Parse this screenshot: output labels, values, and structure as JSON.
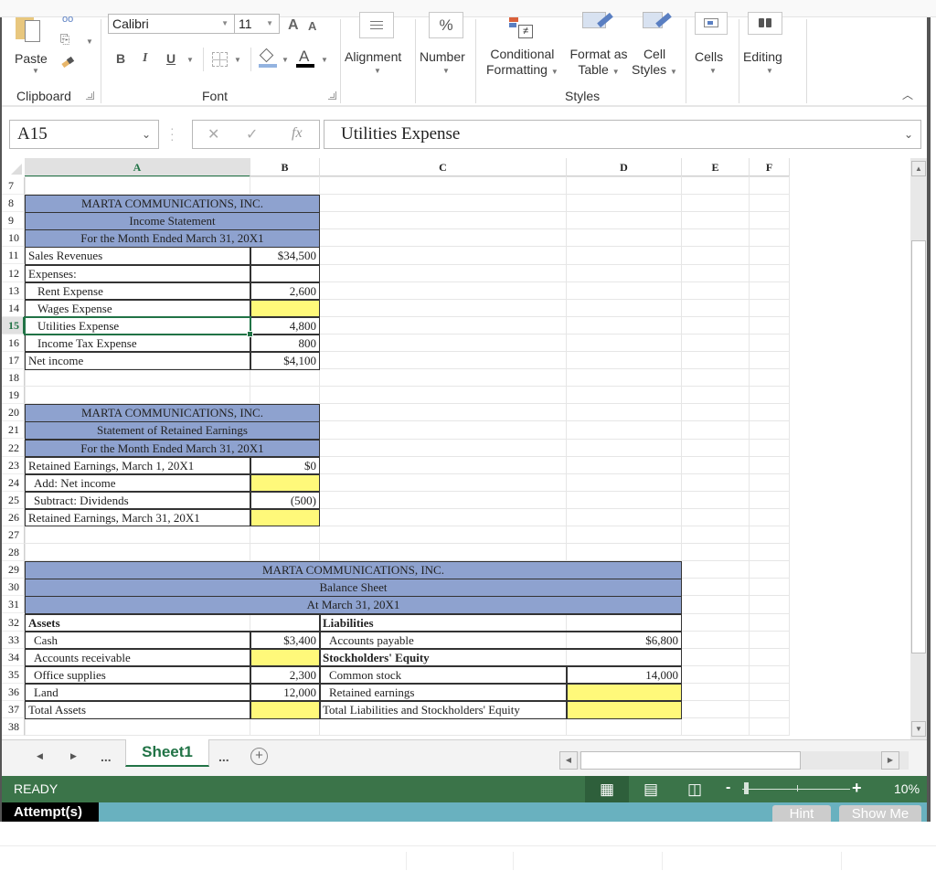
{
  "ribbon": {
    "clipboard": {
      "paste_label": "Paste",
      "group_label": "Clipboard"
    },
    "font": {
      "font_name": "Calibri",
      "font_size": "11",
      "bold": "B",
      "italic": "I",
      "underline": "U",
      "grow_font": "A",
      "shrink_font": "A",
      "group_label": "Font"
    },
    "alignment": {
      "label": "Alignment"
    },
    "number": {
      "label": "Number",
      "icon_glyph": "%"
    },
    "styles": {
      "conditional_formatting_l1": "Conditional",
      "conditional_formatting_l2": "Formatting",
      "format_as_table_l1": "Format as",
      "format_as_table_l2": "Table",
      "cell_styles_l1": "Cell",
      "cell_styles_l2": "Styles",
      "group_label": "Styles"
    },
    "cells": {
      "label": "Cells"
    },
    "editing": {
      "label": "Editing"
    }
  },
  "formula_bar": {
    "name_box": "A15",
    "fx": "fx",
    "content": "Utilities Expense"
  },
  "columns": [
    "A",
    "B",
    "C",
    "D",
    "E",
    "F"
  ],
  "selected_column": "A",
  "rows": [
    "7",
    "8",
    "9",
    "10",
    "11",
    "12",
    "13",
    "14",
    "15",
    "16",
    "17",
    "18",
    "19",
    "20",
    "21",
    "22",
    "23",
    "24",
    "25",
    "26",
    "27",
    "28",
    "29",
    "30",
    "31",
    "32",
    "33",
    "34",
    "35",
    "36",
    "37",
    "38"
  ],
  "selected_row": "15",
  "income_statement": {
    "company": "MARTA COMMUNICATIONS, INC.",
    "title": "Income Statement",
    "period": "For the Month Ended  March 31, 20X1",
    "lines": [
      {
        "label": "Sales Revenues",
        "value": "$34,500",
        "indent": false,
        "input": false
      },
      {
        "label": "Expenses:",
        "value": "",
        "indent": false,
        "input": false
      },
      {
        "label": "Rent Expense",
        "value": "2,600",
        "indent": true,
        "input": false
      },
      {
        "label": "Wages Expense",
        "value": "",
        "indent": true,
        "input": true
      },
      {
        "label": "Utilities Expense",
        "value": "4,800",
        "indent": true,
        "input": false
      },
      {
        "label": "Income Tax Expense",
        "value": "800",
        "indent": true,
        "input": false
      },
      {
        "label": "Net income",
        "value": "$4,100",
        "indent": false,
        "input": false
      }
    ]
  },
  "retained_earnings": {
    "company": "MARTA COMMUNICATIONS, INC.",
    "title": "Statement of Retained Earnings",
    "period": "For the Month Ended  March 31, 20X1",
    "lines": [
      {
        "label": "Retained Earnings, March 1, 20X1",
        "value": "$0",
        "indent": false,
        "input": false
      },
      {
        "label": "Add: Net income",
        "value": "",
        "indent": true,
        "input": true
      },
      {
        "label": "Subtract: Dividends",
        "value": "(500)",
        "indent": true,
        "input": false
      },
      {
        "label": "Retained Earnings, March 31, 20X1",
        "value": "",
        "indent": false,
        "input": true
      }
    ]
  },
  "balance_sheet": {
    "company": "MARTA COMMUNICATIONS, INC.",
    "title": "Balance Sheet",
    "period": "At March 31, 20X1",
    "assets_header": "Assets",
    "assets": [
      {
        "label": "Cash",
        "value": "$3,400",
        "input": false
      },
      {
        "label": "Accounts receivable",
        "value": "",
        "input": true
      },
      {
        "label": "Office supplies",
        "value": "2,300",
        "input": false
      },
      {
        "label": "Land",
        "value": "12,000",
        "input": false
      }
    ],
    "total_assets": {
      "label": "Total Assets",
      "value": "",
      "input": true
    },
    "liabilities_header": "Liabilities",
    "liabilities": [
      {
        "label": "Accounts payable",
        "value": "$6,800",
        "input": false
      }
    ],
    "equity_header": "Stockholders' Equity",
    "equity": [
      {
        "label": "Common stock",
        "value": "14,000",
        "input": false
      },
      {
        "label": "Retained earnings",
        "value": "",
        "input": true
      }
    ],
    "total_le": {
      "label": "Total Liabilities and Stockholders' Equity",
      "value": "",
      "input": true
    }
  },
  "sheet_tabs": {
    "active": "Sheet1",
    "more_left": "...",
    "more_right": "..."
  },
  "status_bar": {
    "mode": "READY",
    "zoom": "10%"
  },
  "attempt_bar": {
    "label": "Attempt(s)",
    "hint": "Hint",
    "show_me": "Show Me"
  },
  "colors": {
    "header_band": "#8ea2cf",
    "input_cell": "#fff97a",
    "excel_green": "#217346",
    "status_green": "#3b7449",
    "attempt_teal": "#69b1bf"
  }
}
